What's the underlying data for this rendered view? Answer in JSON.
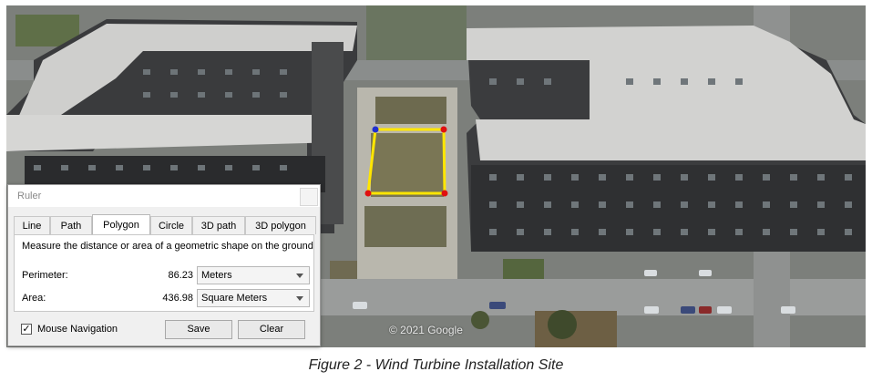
{
  "caption": "Figure 2 - Wind Turbine Installation Site",
  "map": {
    "watermark": "© 2021 Google"
  },
  "ruler": {
    "title": "Ruler",
    "tabs": [
      {
        "label": "Line",
        "active": false
      },
      {
        "label": "Path",
        "active": false
      },
      {
        "label": "Polygon",
        "active": true
      },
      {
        "label": "Circle",
        "active": false
      },
      {
        "label": "3D path",
        "active": false
      },
      {
        "label": "3D polygon",
        "active": false
      }
    ],
    "description": "Measure the distance or area of a geometric shape on the ground",
    "perimeter": {
      "label": "Perimeter:",
      "value": "86.23",
      "unit": "Meters"
    },
    "area": {
      "label": "Area:",
      "value": "436.98",
      "unit": "Square Meters"
    },
    "mouse_navigation": {
      "label": "Mouse Navigation",
      "checked": true
    },
    "save_label": "Save",
    "clear_label": "Clear"
  },
  "colors": {
    "polygon": "#ffe600",
    "vertex": "#e01010",
    "vertex_start": "#2030d0"
  }
}
